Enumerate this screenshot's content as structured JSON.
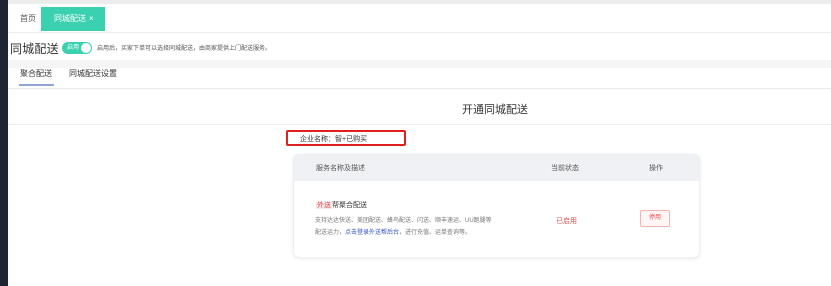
{
  "tabs": {
    "home_label": "首页",
    "active_label": "同城配送",
    "close_glyph": "×"
  },
  "header": {
    "title": "同城配送",
    "toggle_label": "启用",
    "toggle_on": true,
    "hint": "启用后，买家下单可以选择同城配送，由商家提供上门配送服务。"
  },
  "sub_tabs": [
    "聚合配送",
    "同城配送设置"
  ],
  "section": {
    "title": "开通同城配送",
    "company_label": "企业名称：",
    "company_value": "智+已购买"
  },
  "table": {
    "headers": [
      "服务名称及描述",
      "当前状态",
      "操作"
    ],
    "row": {
      "brand": "外送",
      "name_rest": "帮聚合配送",
      "desc_prefix": "支持达达快送、美团配送、蜂鸟配送、闪送、顺丰速运、UU跑腿等配送运力，",
      "desc_link": "点击登录外送帮后台",
      "desc_suffix": "，进行充值、运单查询等。",
      "status": "已启用",
      "action": "停用"
    }
  },
  "colors": {
    "accent": "#3bd1b0",
    "danger": "#e34d4d",
    "highlight_border": "#e02020",
    "link": "#3050c8"
  }
}
